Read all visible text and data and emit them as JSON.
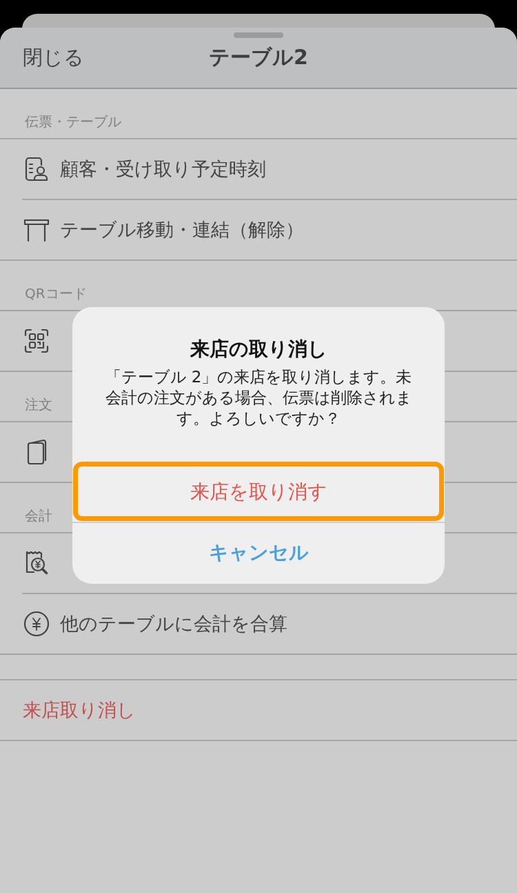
{
  "header": {
    "close": "閉じる",
    "title": "テーブル2"
  },
  "sections": [
    {
      "label": "伝票・テーブル",
      "items": [
        {
          "kind": "customer",
          "text": "顧客・受け取り予定時刻"
        },
        {
          "kind": "table",
          "text": "テーブル移動・連結（解除）"
        }
      ]
    },
    {
      "label": "QRコード",
      "items": [
        {
          "kind": "qr"
        }
      ]
    },
    {
      "label": "注文",
      "items": [
        {
          "kind": "slip"
        }
      ]
    },
    {
      "label": "会計",
      "items": [
        {
          "kind": "receipt"
        },
        {
          "kind": "yen",
          "text": "他のテーブルに会計を合算"
        }
      ]
    }
  ],
  "cancel_visit": {
    "text": "来店取り消し"
  },
  "dialog": {
    "title": "来店の取り消し",
    "message": "「テーブル 2」の来店を取り消します。未会計の注文がある場合、伝票は削除されます。よろしいですか？",
    "buttons": [
      {
        "label": "来店を取り消す",
        "kind": "destructive",
        "highlighted": true
      },
      {
        "label": "キャンセル",
        "kind": "cancel",
        "highlighted": false
      }
    ]
  }
}
